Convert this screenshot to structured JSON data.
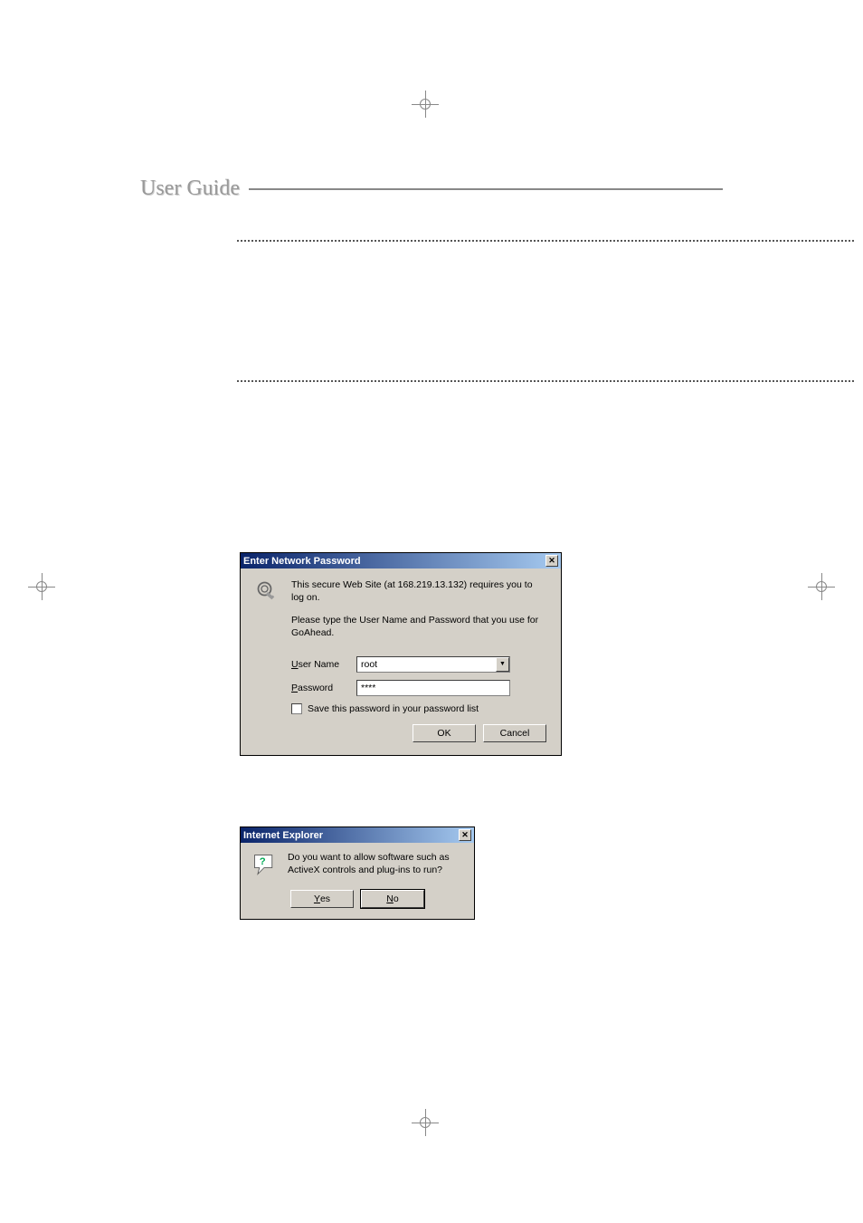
{
  "page_header": "User Guide",
  "dialog1": {
    "title": "Enter Network Password",
    "close_glyph": "✕",
    "line1": "This secure Web Site (at 168.219.13.132) requires you to log on.",
    "line2": "Please type the User Name and Password that you use for GoAhead.",
    "user_label_pre": "U",
    "user_label_rest": "ser Name",
    "user_value": "root",
    "pass_label_pre": "P",
    "pass_label_rest": "assword",
    "pass_value": "****",
    "save_pre": "S",
    "save_rest": "ave this password in your password list",
    "ok": "OK",
    "cancel": "Cancel",
    "dropdown_glyph": "▼"
  },
  "dialog2": {
    "title": "Internet Explorer",
    "close_glyph": "✕",
    "message": "Do you want to allow software such as ActiveX controls and plug-ins to run?",
    "yes_pre": "Y",
    "yes_rest": "es",
    "no_pre": "N",
    "no_rest": "o"
  }
}
